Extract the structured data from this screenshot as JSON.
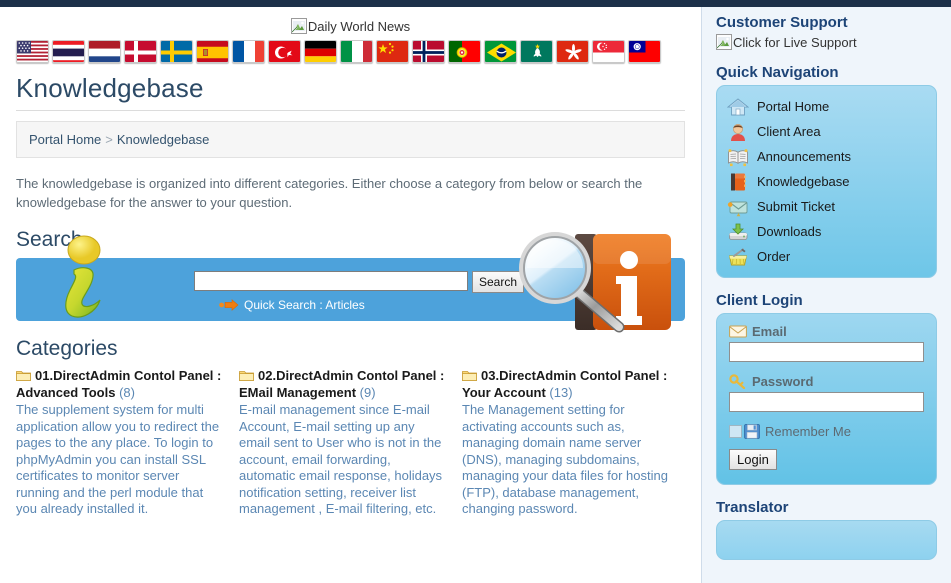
{
  "header": {
    "news_label": "Daily World News",
    "news_icon": "broken-image-icon",
    "flags": [
      {
        "name": "flag-usa",
        "title": "United States"
      },
      {
        "name": "flag-thailand",
        "title": "Thailand"
      },
      {
        "name": "flag-netherlands",
        "title": "Netherlands"
      },
      {
        "name": "flag-denmark",
        "title": "Denmark"
      },
      {
        "name": "flag-sweden",
        "title": "Sweden"
      },
      {
        "name": "flag-spain",
        "title": "Spain"
      },
      {
        "name": "flag-france",
        "title": "France"
      },
      {
        "name": "flag-turkey",
        "title": "Turkey"
      },
      {
        "name": "flag-germany",
        "title": "Germany"
      },
      {
        "name": "flag-italy",
        "title": "Italy"
      },
      {
        "name": "flag-china",
        "title": "China"
      },
      {
        "name": "flag-norway",
        "title": "Norway"
      },
      {
        "name": "flag-portugal",
        "title": "Portugal"
      },
      {
        "name": "flag-brazil",
        "title": "Brazil"
      },
      {
        "name": "flag-macau",
        "title": "Macau"
      },
      {
        "name": "flag-hongkong",
        "title": "Hong Kong"
      },
      {
        "name": "flag-singapore",
        "title": "Singapore"
      },
      {
        "name": "flag-taiwan",
        "title": "Taiwan"
      }
    ]
  },
  "page": {
    "title": "Knowledgebase",
    "breadcrumb": {
      "home": "Portal Home",
      "separator": ">",
      "current": "Knowledgebase"
    },
    "intro": "The knowledgebase is organized into different categories. Either choose a category from below or search the knowledgebase for the answer to your question."
  },
  "search": {
    "heading": "Search",
    "input_value": "",
    "input_placeholder": "",
    "button_label": "Search",
    "quick_search_label": "Quick Search : Articles"
  },
  "categories": {
    "heading": "Categories",
    "items": [
      {
        "title": "01.DirectAdmin Contol Panel : Advanced Tools",
        "count": "(8)",
        "description": "The supplement system for multi application allow you to redirect the pages to the any place. To login to phpMyAdmin you can install SSL certificates to monitor server running and the perl module that you already installed it."
      },
      {
        "title": "02.DirectAdmin Contol Panel : EMail Management",
        "count": "(9)",
        "description": "E-mail management since E-mail Account, E-mail setting up any email sent to User who is not in the account, email forwarding, automatic email response, holidays notification setting, receiver list management , E-mail filtering, etc."
      },
      {
        "title": "03.DirectAdmin Contol Panel : Your Account",
        "count": "(13)",
        "description": "The Management setting for activating accounts such as, managing domain name server (DNS), managing subdomains, managing your data files for hosting (FTP), database management, changing password."
      }
    ]
  },
  "sidebar": {
    "customer_support_heading": "Customer Support",
    "live_support_label": "Click for Live Support",
    "live_support_icon": "broken-image-icon",
    "quick_navigation_heading": "Quick Navigation",
    "nav_items": [
      {
        "label": "Portal Home",
        "icon": "house-icon"
      },
      {
        "label": "Client Area",
        "icon": "user-icon"
      },
      {
        "label": "Announcements",
        "icon": "newspaper-icon"
      },
      {
        "label": "Knowledgebase",
        "icon": "book-icon"
      },
      {
        "label": "Submit Ticket",
        "icon": "envelope-icon"
      },
      {
        "label": "Downloads",
        "icon": "download-drive-icon"
      },
      {
        "label": "Order",
        "icon": "shopping-basket-icon"
      }
    ],
    "client_login": {
      "heading": "Client Login",
      "email_label": "Email",
      "email_icon": "envelope-icon",
      "email_value": "",
      "password_label": "Password",
      "password_icon": "key-icon",
      "password_value": "",
      "remember_label": "Remember Me",
      "remember_icon": "floppy-disk-icon",
      "remember_checked": false,
      "login_button": "Login"
    },
    "translator_heading": "Translator"
  },
  "colors": {
    "accent_blue": "#4da2db",
    "panel_blue": "#6ec6e8",
    "sidebar_bg": "#eff5fb",
    "heading_navy": "#1d4477",
    "link_blue": "#5b87b3",
    "topstrip": "#1d3049"
  }
}
